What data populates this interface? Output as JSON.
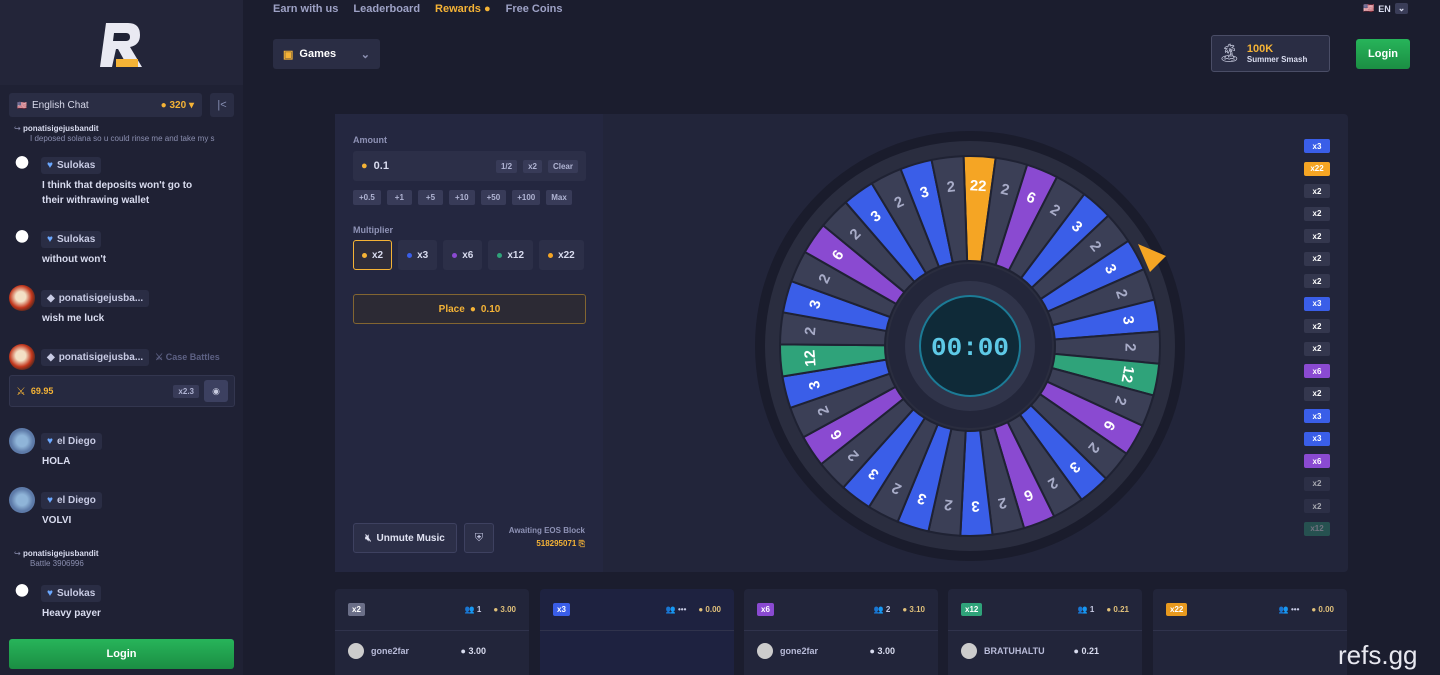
{
  "nav": {
    "links": [
      "Earn with us",
      "Leaderboard",
      "Rewards",
      "Free Coins"
    ],
    "games_label": "Games",
    "language": "EN",
    "login_label": "Login",
    "promo": {
      "amount": "100K",
      "label": "Summer Smash"
    }
  },
  "chat": {
    "channel": "English Chat",
    "online": "320",
    "login_label": "Login",
    "messages": [
      {
        "user": "ponatisigejusbandit",
        "text": "I deposed solana so u could rinse me and take my s",
        "type": "reply"
      },
      {
        "user": "Sulokas",
        "text": "I think that deposits won't go to their withrawing wallet"
      },
      {
        "user": "Sulokas",
        "text": "without won't"
      },
      {
        "user": "ponatisigejusba...",
        "text": "wish me luck"
      },
      {
        "user": "ponatisigejusba...",
        "tag": "Case Battles",
        "amount": "69.95",
        "mult": "x2.3"
      },
      {
        "user": "el Diego",
        "text": "HOLA"
      },
      {
        "user": "el Diego",
        "text": "VOLVI"
      },
      {
        "user": "ponatisigejusbandit",
        "text": "Battle 3906996",
        "type": "reply"
      },
      {
        "user": "Sulokas",
        "text": "Heavy payer"
      }
    ]
  },
  "controls": {
    "amount_label": "Amount",
    "amount_value": "0.1",
    "half": "1/2",
    "double": "x2",
    "clear": "Clear",
    "increments": [
      "+0.5",
      "+1",
      "+5",
      "+10",
      "+50",
      "+100",
      "Max"
    ],
    "multiplier_label": "Multiplier",
    "multipliers": [
      "x2",
      "x3",
      "x6",
      "x12",
      "x22"
    ],
    "place_label": "Place",
    "place_amount": "0.10",
    "unmute_label": "Unmute Music",
    "eos_label": "Awaiting EOS Block",
    "eos_block": "518295071"
  },
  "wheel": {
    "timer": "00:00",
    "segments": [
      "22",
      "2",
      "6",
      "2",
      "3",
      "2",
      "3",
      "2",
      "3",
      "2",
      "12",
      "2",
      "6",
      "2",
      "3",
      "2",
      "6",
      "2",
      "3",
      "2",
      "3",
      "2",
      "3",
      "2",
      "6",
      "2",
      "3",
      "12",
      "2",
      "3",
      "2",
      "6",
      "2",
      "3",
      "2",
      "3",
      "2"
    ]
  },
  "history": [
    "x3",
    "x22",
    "x2",
    "x2",
    "x2",
    "x2",
    "x2",
    "x3",
    "x2",
    "x2",
    "x6",
    "x2",
    "x3",
    "x3",
    "x6",
    "x2",
    "x2",
    "x12"
  ],
  "colors": {
    "x2": "#6b6f88",
    "x3": "#3a5ee8",
    "x6": "#8a4ad1",
    "x12": "#2fa37a",
    "x22": "#f5a524"
  },
  "bets": [
    {
      "tag": "x2",
      "players": "1",
      "total": "3.00",
      "rows": [
        {
          "user": "gone2far",
          "amount": "3.00"
        }
      ]
    },
    {
      "tag": "x3",
      "players": "•••",
      "total": "0.00",
      "rows": []
    },
    {
      "tag": "x6",
      "players": "2",
      "total": "3.10",
      "rows": [
        {
          "user": "gone2far",
          "amount": "3.00"
        }
      ]
    },
    {
      "tag": "x12",
      "players": "1",
      "total": "0.21",
      "rows": [
        {
          "user": "BRATUHALTU",
          "amount": "0.21"
        }
      ]
    },
    {
      "tag": "x22",
      "players": "•••",
      "total": "0.00",
      "rows": []
    }
  ],
  "watermark": "refs.gg"
}
